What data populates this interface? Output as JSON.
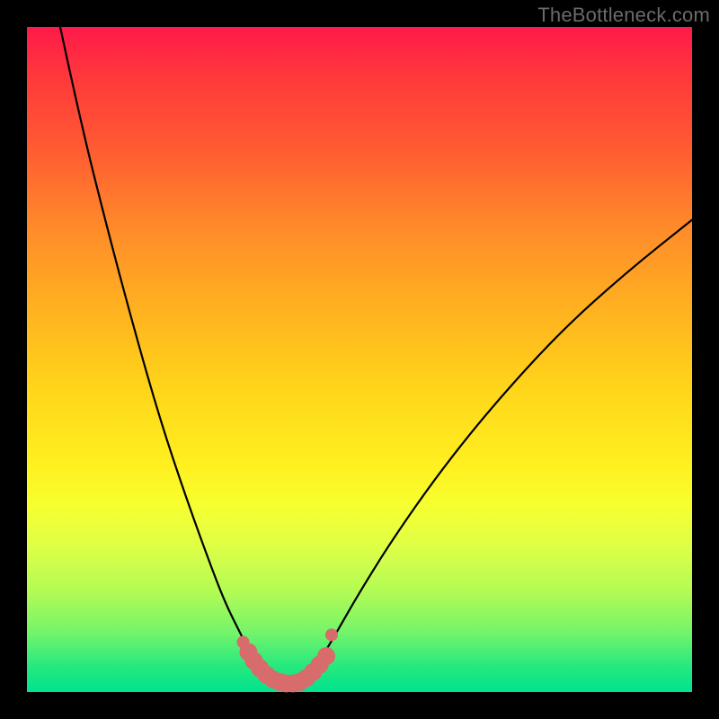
{
  "watermark": "TheBottleneck.com",
  "colors": {
    "background": "#000000",
    "curve_stroke": "#000000",
    "marker_fill": "#d86b6b",
    "marker_stroke": "#c25858",
    "gradient_top": "#ff1a4a",
    "gradient_bottom": "#00e38e"
  },
  "chart_data": {
    "type": "line",
    "title": "",
    "xlabel": "",
    "ylabel": "",
    "xlim": [
      0,
      100
    ],
    "ylim": [
      0,
      100
    ],
    "grid": false,
    "series": [
      {
        "name": "left-branch",
        "x": [
          5,
          8,
          12,
          16,
          20,
          24,
          28,
          30,
          32,
          33.5,
          35
        ],
        "y": [
          100,
          86,
          70,
          55,
          41,
          29,
          18,
          13,
          9,
          6,
          3
        ]
      },
      {
        "name": "floor",
        "x": [
          35,
          37,
          39,
          41,
          43
        ],
        "y": [
          3,
          1.5,
          1.2,
          1.5,
          3
        ]
      },
      {
        "name": "right-branch",
        "x": [
          43,
          46,
          50,
          55,
          62,
          70,
          80,
          90,
          100
        ],
        "y": [
          3,
          8,
          15,
          23,
          33,
          43,
          54,
          63,
          71
        ]
      }
    ],
    "highlight_points": {
      "name": "markers",
      "x": [
        32.5,
        33.3,
        34.1,
        35,
        36,
        37,
        38,
        39,
        40,
        41,
        42,
        43,
        44,
        45,
        45.8
      ],
      "y": [
        7.5,
        6,
        4.7,
        3.6,
        2.6,
        1.9,
        1.5,
        1.3,
        1.3,
        1.5,
        2.1,
        3.0,
        4.1,
        5.4,
        8.6
      ]
    }
  }
}
